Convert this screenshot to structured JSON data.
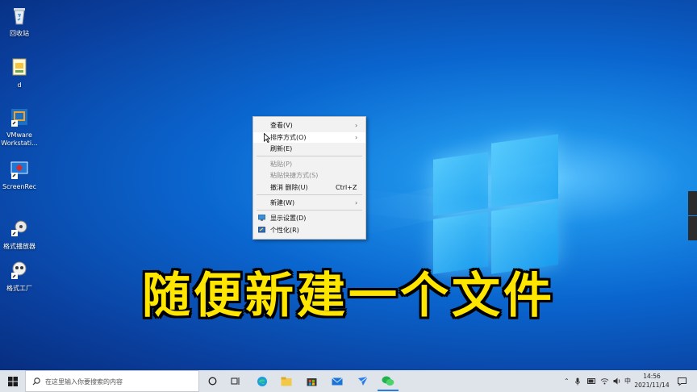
{
  "desktop": {
    "icons": [
      {
        "label": "回收站",
        "icon": "recycle-bin-icon"
      },
      {
        "label": "d",
        "icon": "folder-file-icon"
      },
      {
        "label": "VMware Workstati...",
        "icon": "vmware-icon"
      },
      {
        "label": "ScreenRec",
        "icon": "screenrec-icon"
      },
      {
        "label": "格式播放器",
        "icon": "player-icon"
      },
      {
        "label": "格式工厂",
        "icon": "format-factory-icon"
      }
    ]
  },
  "context_menu": {
    "items": [
      {
        "label": "查看(V)",
        "has_submenu": true,
        "enabled": true
      },
      {
        "label": "排序方式(O)",
        "has_submenu": true,
        "enabled": true,
        "highlighted": true
      },
      {
        "label": "刷新(E)",
        "enabled": true
      },
      {
        "label": "粘贴(P)",
        "enabled": false
      },
      {
        "label": "粘贴快捷方式(S)",
        "enabled": false
      },
      {
        "label": "撤消 删除(U)",
        "shortcut": "Ctrl+Z",
        "enabled": true
      },
      {
        "label": "新建(W)",
        "has_submenu": true,
        "enabled": true
      },
      {
        "label": "显示设置(D)",
        "icon": "display-settings-icon",
        "enabled": true
      },
      {
        "label": "个性化(R)",
        "icon": "personalize-icon",
        "enabled": true
      }
    ]
  },
  "caption": "随便新建一个文件",
  "taskbar": {
    "search_placeholder": "在这里输入你要搜索的内容",
    "apps": [
      "task-view-icon",
      "timeline-icon",
      "edge-icon",
      "file-explorer-icon",
      "store-icon",
      "mail-icon",
      "feishu-icon",
      "wechat-icon"
    ],
    "tray": {
      "ime": "中",
      "time": "14:56",
      "date": "2021/11/14"
    }
  },
  "colors": {
    "caption_fill": "#ffe600",
    "caption_stroke": "#000000",
    "taskbar_bg": "#dfe3ea",
    "menu_bg": "#f2f2f2"
  }
}
